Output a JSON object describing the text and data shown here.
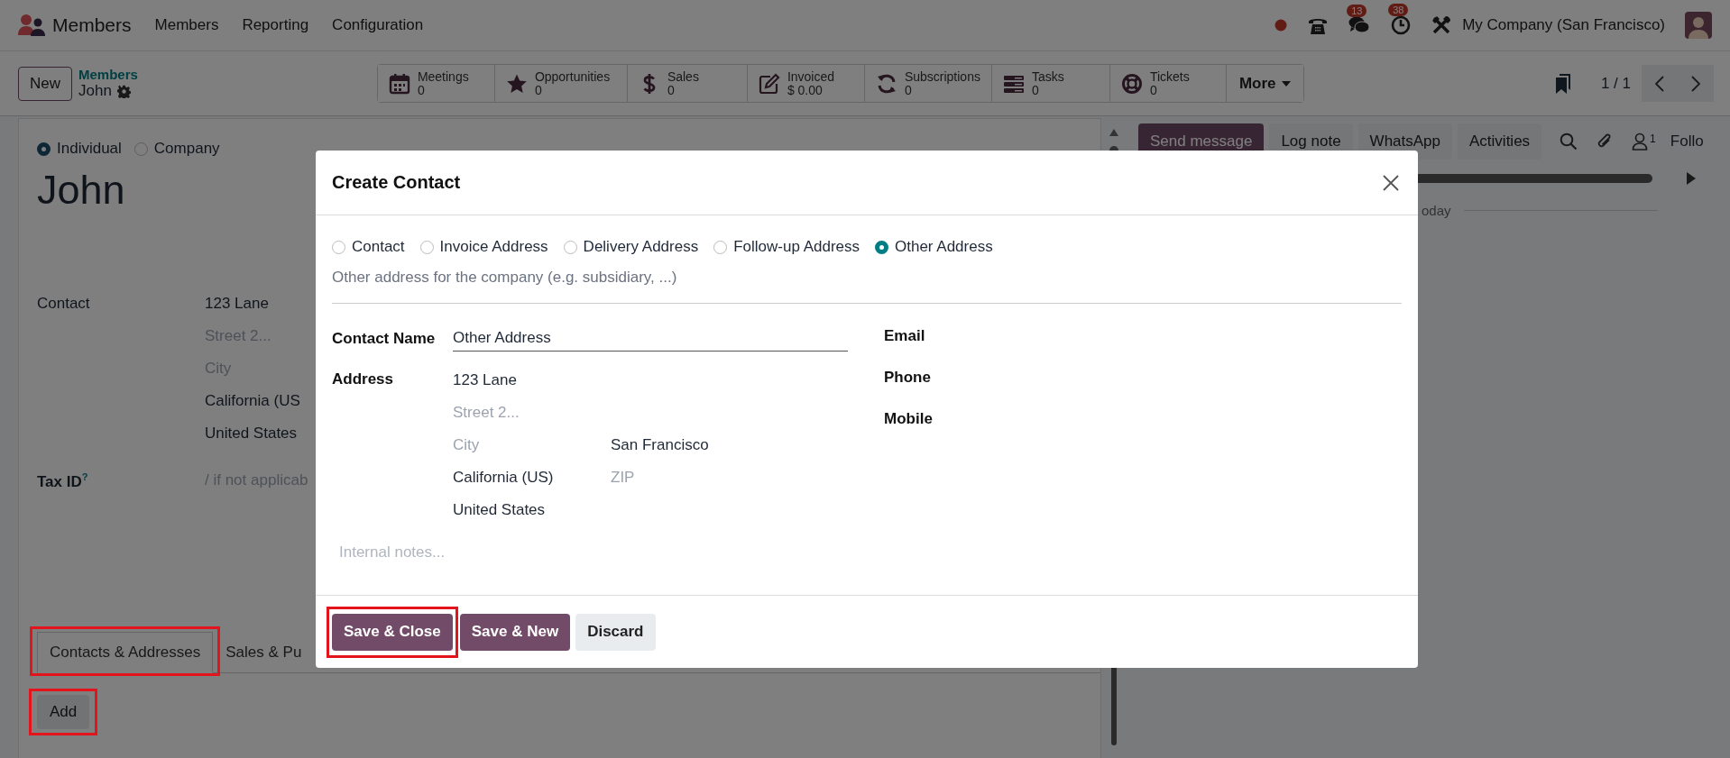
{
  "app": {
    "name": "Members"
  },
  "menu": [
    "Members",
    "Reporting",
    "Configuration"
  ],
  "systray": {
    "chat_count": "13",
    "activity_count": "38",
    "company": "My Company (San Francisco)"
  },
  "control_panel": {
    "new_button": "New",
    "breadcrumb": "Members",
    "record": "John",
    "stat_buttons": [
      {
        "kind": "calendar",
        "label": "Meetings",
        "value": "0"
      },
      {
        "kind": "star",
        "label": "Opportunities",
        "value": "0"
      },
      {
        "kind": "dollar",
        "label": "Sales",
        "value": "0"
      },
      {
        "kind": "edit",
        "label": "Invoiced",
        "value": "$ 0.00"
      },
      {
        "kind": "refresh",
        "label": "Subscriptions",
        "value": "0"
      },
      {
        "kind": "tasks",
        "label": "Tasks",
        "value": "0"
      },
      {
        "kind": "lifebuoy",
        "label": "Tickets",
        "value": "0"
      }
    ],
    "more": "More",
    "pager": "1 / 1"
  },
  "form": {
    "types": [
      {
        "label": "Individual",
        "selected": true
      },
      {
        "label": "Company",
        "selected": false
      }
    ],
    "name": "John",
    "fields": [
      {
        "label": "Contact",
        "rows": [
          [
            {
              "value": "123 Lane"
            }
          ],
          [
            {
              "placeholder": "Street 2..."
            }
          ],
          [
            {
              "placeholder": "City"
            }
          ],
          [
            {
              "value": "California (US"
            }
          ],
          [
            {
              "value": "United States"
            }
          ]
        ]
      },
      {
        "label": "Tax ID$^{?}$",
        "rows": [
          [
            {
              "placeholder": "/ if not applicab"
            }
          ]
        ]
      }
    ],
    "tabs": [
      {
        "label": "Contacts & Addresses",
        "selected": true,
        "highlighted": true
      },
      {
        "label": "Sales & Pu",
        "selected": false,
        "highlighted": false
      }
    ],
    "add_button": {
      "label": "Add",
      "highlighted": true
    }
  },
  "chatter": {
    "buttons": [
      {
        "label": "Send message",
        "selected": true
      },
      {
        "label": "Log note",
        "selected": false
      },
      {
        "label": "WhatsApp",
        "selected": false
      },
      {
        "label": "Activities",
        "selected": false
      }
    ],
    "follower_count": "1",
    "follow": "Follo",
    "date_divider": "oday"
  },
  "dialog": {
    "title": "Create Contact",
    "types": [
      {
        "label": "Contact",
        "selected": false
      },
      {
        "label": "Invoice Address",
        "selected": false
      },
      {
        "label": "Delivery Address",
        "selected": false
      },
      {
        "label": "Follow-up Address",
        "selected": false
      },
      {
        "label": "Other Address",
        "selected": true
      }
    ],
    "description": "Other address for the company (e.g. subsidiary, ...)",
    "contact_name": {
      "label": "Contact Name",
      "value": "Other Address"
    },
    "address": {
      "label": "Address",
      "rows": [
        [
          {
            "value": "123 Lane"
          }
        ],
        [
          {
            "placeholder": "Street 2..."
          }
        ],
        [
          {
            "placeholder": "City"
          },
          {
            "value": "San Francisco"
          }
        ],
        [
          {
            "value": "California (US)"
          },
          {
            "placeholder": "ZIP"
          }
        ],
        [
          {
            "value": "United States"
          }
        ]
      ]
    },
    "right_fields": [
      "Email",
      "Phone",
      "Mobile"
    ],
    "notes_placeholder": "Internal notes...",
    "buttons": [
      {
        "label": "Save & Close",
        "kind": "primary",
        "highlighted": true
      },
      {
        "label": "Save & New",
        "kind": "primary",
        "highlighted": false
      },
      {
        "label": "Discard",
        "kind": "secondary",
        "highlighted": false
      }
    ]
  }
}
